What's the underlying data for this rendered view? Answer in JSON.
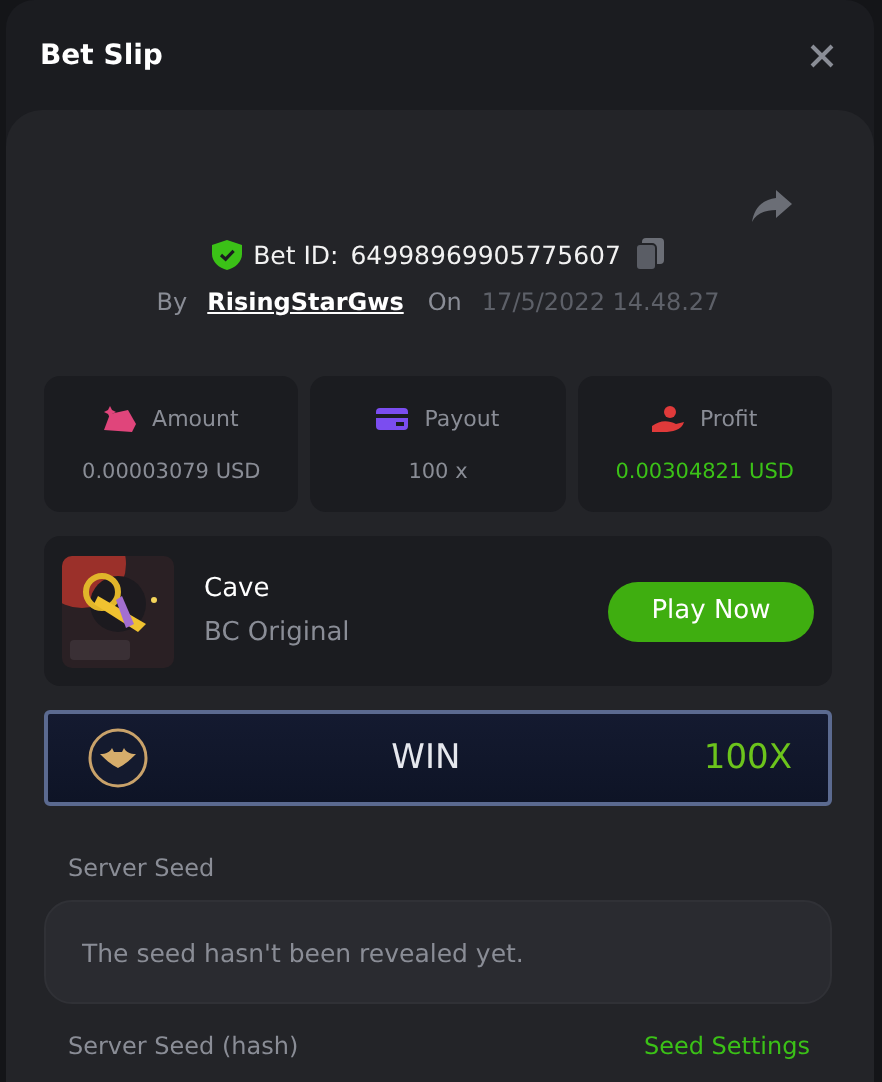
{
  "window": {
    "title": "Bet Slip"
  },
  "bet": {
    "id_label": "Bet ID:",
    "id": "64998969905775607",
    "by_label": "By",
    "user": "RisingStarGws",
    "on_label": "On",
    "date": "17/5/2022 14.48.27"
  },
  "stats": [
    {
      "kind": "amount",
      "label": "Amount",
      "value": "0.00003079 USD",
      "color": "#e0457b",
      "positive": false
    },
    {
      "kind": "payout",
      "label": "Payout",
      "value": "100 x",
      "color": "#7b4df0",
      "positive": false
    },
    {
      "kind": "profit",
      "label": "Profit",
      "value": "0.00304821 USD",
      "color": "#e03a3a",
      "positive": true
    }
  ],
  "game": {
    "name": "Cave",
    "provider": "BC Original",
    "button": "Play Now"
  },
  "result": {
    "label": "WIN",
    "multiplier": "100X"
  },
  "server_seed": {
    "label": "Server Seed",
    "placeholder": "The seed hasn't been revealed yet."
  },
  "footer": {
    "label": "Server Seed (hash)",
    "link": "Seed Settings"
  }
}
